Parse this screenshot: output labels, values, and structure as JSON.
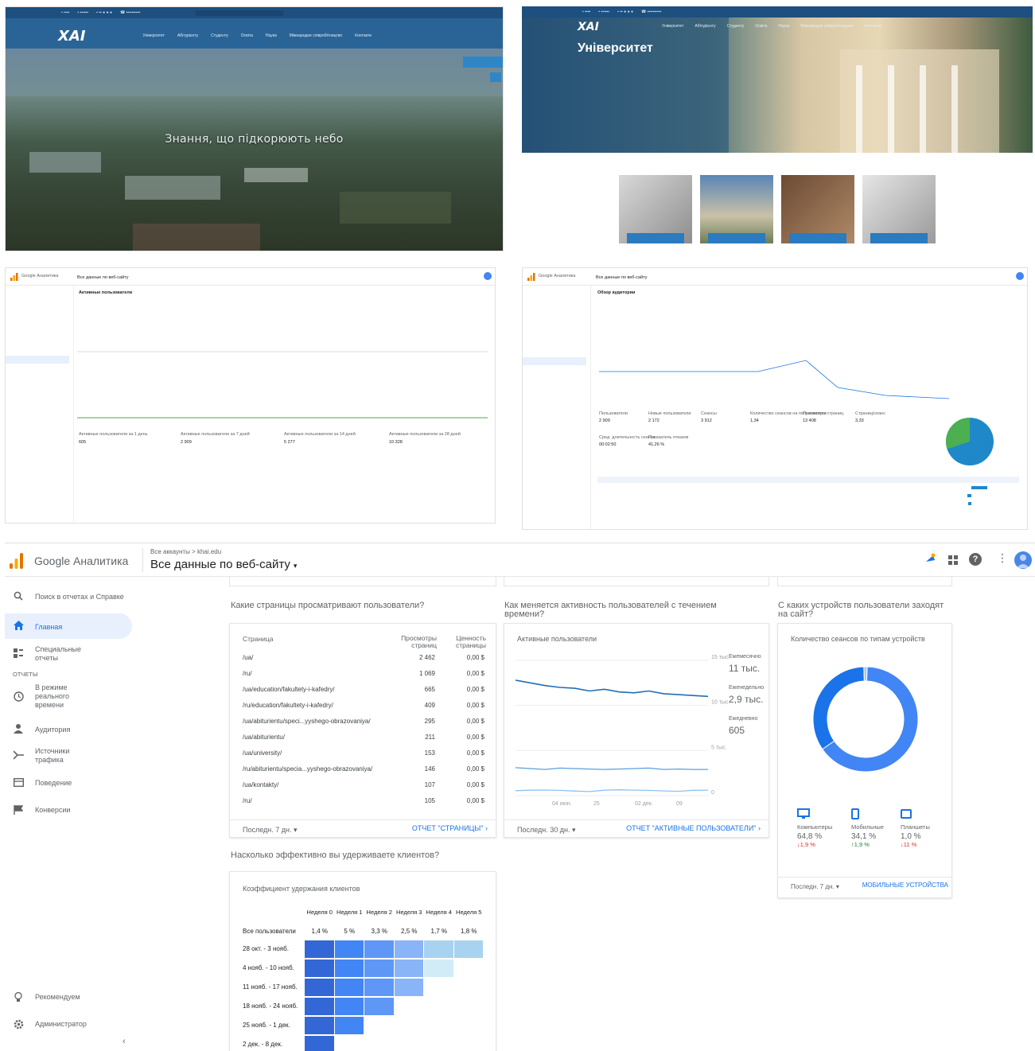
{
  "site_home": {
    "logo": "ХАІ",
    "menu": [
      "Університет",
      "Абітурієнту",
      "Студенту",
      "Освіта",
      "Наука",
      "Міжнародне співробітництво",
      "Контакти"
    ],
    "hero_text": "Знання, що підкорюють небо"
  },
  "site_univ": {
    "logo": "ХАІ",
    "title": "Університет",
    "menu": [
      "Університет",
      "Абітурієнту",
      "Студенту",
      "Освіта",
      "Наука",
      "Міжнародне співробітництво",
      "Контакти"
    ]
  },
  "ga_mini_1": {
    "app": "Google Аналитика",
    "view": "Все данные по веб-сайту",
    "card_title": "Активные пользователи",
    "metrics": [
      {
        "label": "Активные пользователи за 1 день",
        "value": "605"
      },
      {
        "label": "Активные пользователи за 7 дней",
        "value": "2 909"
      },
      {
        "label": "Активные пользователи за 14 дней",
        "value": "5 277"
      },
      {
        "label": "Активные пользователи за 28 дней",
        "value": "10 328"
      }
    ]
  },
  "ga_mini_2": {
    "app": "Google Аналитика",
    "view": "Все данные по веб-сайту",
    "card_title": "Обзор аудитории",
    "metrics": [
      {
        "label": "Пользователи",
        "value": "2 909"
      },
      {
        "label": "Новые пользователи",
        "value": "2 172"
      },
      {
        "label": "Сеансы",
        "value": "3 912"
      },
      {
        "label": "Количество сеансов на пользователя",
        "value": "1,34"
      },
      {
        "label": "Просмотры страниц",
        "value": "13 408"
      },
      {
        "label": "Страниц/сеанс",
        "value": "3,33"
      },
      {
        "label": "Сред. длительность сеанса",
        "value": "00:02:50"
      },
      {
        "label": "Показатель отказов",
        "value": "41,26 %"
      }
    ]
  },
  "ga": {
    "app": "Google Аналитика",
    "breadcrumb": "Все аккаунты > khai.edu",
    "view": "Все данные по веб-сайту",
    "search_placeholder": "Поиск в отчетах и Справке",
    "nav": {
      "home": "Главная",
      "custom": "Специальные отчеты",
      "section": "ОТЧЕТЫ",
      "realtime": "В режиме реального времени",
      "audience": "Аудитория",
      "acquisition": "Источники трафика",
      "behavior": "Поведение",
      "conversions": "Конверсии",
      "recommend": "Рекомендуем",
      "admin": "Администратор"
    },
    "pages": {
      "question": "Какие страницы просматривают пользователи?",
      "headers": [
        "Страница",
        "Просмотры страниц",
        "Ценность страницы"
      ],
      "rows": [
        {
          "page": "/ua/",
          "views": "2 462",
          "value": "0,00 $"
        },
        {
          "page": "/ru/",
          "views": "1 069",
          "value": "0,00 $"
        },
        {
          "page": "/ua/education/fakultety-i-kafedry/",
          "views": "665",
          "value": "0,00 $"
        },
        {
          "page": "/ru/education/fakultety-i-kafedry/",
          "views": "409",
          "value": "0,00 $"
        },
        {
          "page": "/ua/abiturientu/speci...yyshego-obrazovaniya/",
          "views": "295",
          "value": "0,00 $"
        },
        {
          "page": "/ua/abiturientu/",
          "views": "211",
          "value": "0,00 $"
        },
        {
          "page": "/ua/university/",
          "views": "153",
          "value": "0,00 $"
        },
        {
          "page": "/ru/abiturientu/specia...yyshego-obrazovaniya/",
          "views": "146",
          "value": "0,00 $"
        },
        {
          "page": "/ua/kontakty/",
          "views": "107",
          "value": "0,00 $"
        },
        {
          "page": "/ru/",
          "views": "105",
          "value": "0,00 $"
        }
      ],
      "period": "Последн. 7 дн.",
      "link": "ОТЧЕТ \"СТРАНИЦЫ\""
    },
    "active": {
      "question": "Как меняется активность пользователей с течением времени?",
      "card_title": "Активные пользователи",
      "y_ticks": [
        "15 тыс.",
        "10 тыс.",
        "5 тыс.",
        "0"
      ],
      "x_ticks": [
        "04 июн.",
        "25",
        "02 дек.",
        "09"
      ],
      "legend": [
        {
          "label": "Ежемесячно",
          "value": "11 тыс."
        },
        {
          "label": "Еженедельно",
          "value": "2,9 тыс."
        },
        {
          "label": "Ежедневно",
          "value": "605"
        }
      ],
      "period": "Последн. 30 дн.",
      "link": "ОТЧЕТ \"АКТИВНЫЕ ПОЛЬЗОВАТЕЛИ\""
    },
    "devices": {
      "question": "С каких устройств пользователи заходят на сайт?",
      "card_title": "Количество сеансов по типам устройств",
      "items": [
        {
          "label": "Компьютеры",
          "value": "64,8 %",
          "change": "↓1,9 %"
        },
        {
          "label": "Мобильные",
          "value": "34,1 %",
          "change": "↑1,9 %"
        },
        {
          "label": "Планшеты",
          "value": "1,0 %",
          "change": "↓11 %"
        }
      ],
      "period": "Последн. 7 дн.",
      "link": "МОБИЛЬНЫЕ УСТРОЙСТВА"
    },
    "cohort": {
      "question": "Насколько эффективно вы удерживаете клиентов?",
      "card_title": "Коэффициент удержания клиентов",
      "columns": [
        "Неделя 0",
        "Неделя 1",
        "Неделя 2",
        "Неделя 3",
        "Неделя 4",
        "Неделя 5"
      ],
      "all_label": "Все пользователи",
      "all_values": [
        "1,4 %",
        "5 %",
        "3,3 %",
        "2,5 %",
        "1,7 %",
        "1,8 %"
      ],
      "rows": [
        "28 окт. - 3 нояб.",
        "4 нояб. - 10 нояб.",
        "11 нояб. - 17 нояб.",
        "18 нояб. - 24 нояб.",
        "25 нояб. - 1 дек.",
        "2 дек. - 8 дек."
      ]
    }
  },
  "chart_data": [
    {
      "type": "line",
      "title": "Активные пользователи",
      "ylim": [
        0,
        15000
      ],
      "series": [
        {
          "name": "Ежемесячно",
          "values": [
            12800,
            12500,
            12200,
            12000,
            11900,
            11600,
            11800,
            11500,
            11400,
            11600,
            11300,
            11200,
            11100,
            11000
          ]
        },
        {
          "name": "Еженедельно",
          "values": [
            3100,
            3000,
            2900,
            3050,
            3000,
            2950,
            2900,
            2950,
            3000,
            3050,
            2900,
            2950,
            2900,
            2900
          ]
        },
        {
          "name": "Ежедневно",
          "values": [
            550,
            600,
            620,
            580,
            500,
            450,
            600,
            640,
            610,
            580,
            520,
            480,
            590,
            605
          ]
        }
      ]
    },
    {
      "type": "pie",
      "title": "Количество сеансов по типам устройств",
      "categories": [
        "Компьютеры",
        "Мобильные",
        "Планшеты"
      ],
      "values": [
        64.8,
        34.1,
        1.0
      ]
    },
    {
      "type": "heatmap",
      "title": "Коэффициент удержания клиентов",
      "rows": 6,
      "cols": 6,
      "values": [
        [
          100,
          4.5,
          3.2,
          2.4,
          1.6,
          1.8
        ],
        [
          100,
          5.1,
          3.4,
          2.6,
          1.2,
          null
        ],
        [
          100,
          4.8,
          3.1,
          2.5,
          null,
          null
        ],
        [
          100,
          5.0,
          3.3,
          null,
          null,
          null
        ],
        [
          100,
          5.2,
          null,
          null,
          null,
          null
        ],
        [
          100,
          null,
          null,
          null,
          null,
          null
        ]
      ]
    }
  ]
}
